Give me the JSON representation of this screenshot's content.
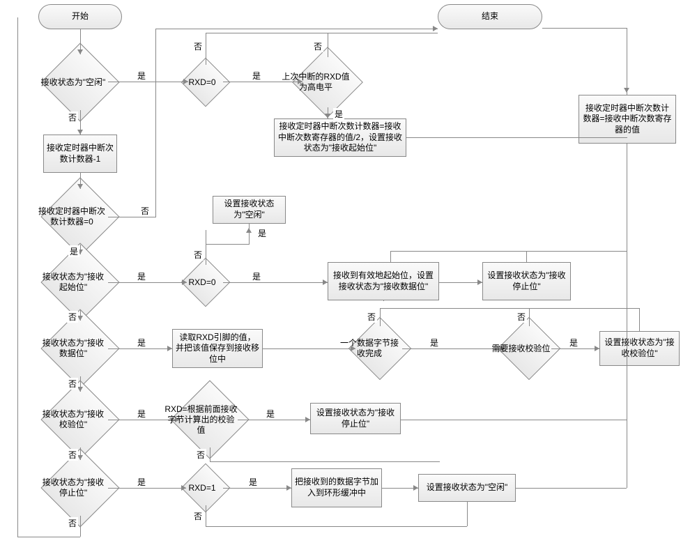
{
  "terminals": {
    "start": "开始",
    "end": "结束"
  },
  "decisions": {
    "d1": "接收状态为\"空闲\"",
    "d2": "RXD=0",
    "d3": "上次中断的RXD值为高电平",
    "d4": "接收定时器中断次数计数器=0",
    "d5": "接收状态为\"接收起始位\"",
    "d6": "RXD=0",
    "d7": "一个数据字节接收完成",
    "d8": "需要接收校验位",
    "d9": "接收状态为\"接收数据位\"",
    "d10": "接收状态为\"接收校验位\"",
    "d11": "RXD=根据前面接收字节计算出的校验值",
    "d12": "接收状态为\"接收停止位\"",
    "d13": "RXD=1"
  },
  "processes": {
    "p1": "接收定时器中断次数计数器-1",
    "p2": "接收定时器中断次数计数器=接收中断次数寄存器的值/2，设置接收状态为\"接收起始位\"",
    "p3": "接收定时器中断次数计数器=接收中断次数寄存器的值",
    "p4": "设置接收状态为\"空闲\"",
    "p5": "接收到有效地起始位，设置接收状态为\"接收数据位\"",
    "p6": "设置接收状态为\"接收停止位\"",
    "p7": "读取RXD引脚的值，并把该值保存到接收移位中",
    "p8": "设置接收状态为\"接收校验位\"",
    "p9": "设置接收状态为\"接收停止位\"",
    "p10": "把接收到的数据字节加入到环形缓冲中",
    "p11": "设置接收状态为\"空闲\""
  },
  "labels": {
    "yes": "是",
    "no": "否"
  }
}
